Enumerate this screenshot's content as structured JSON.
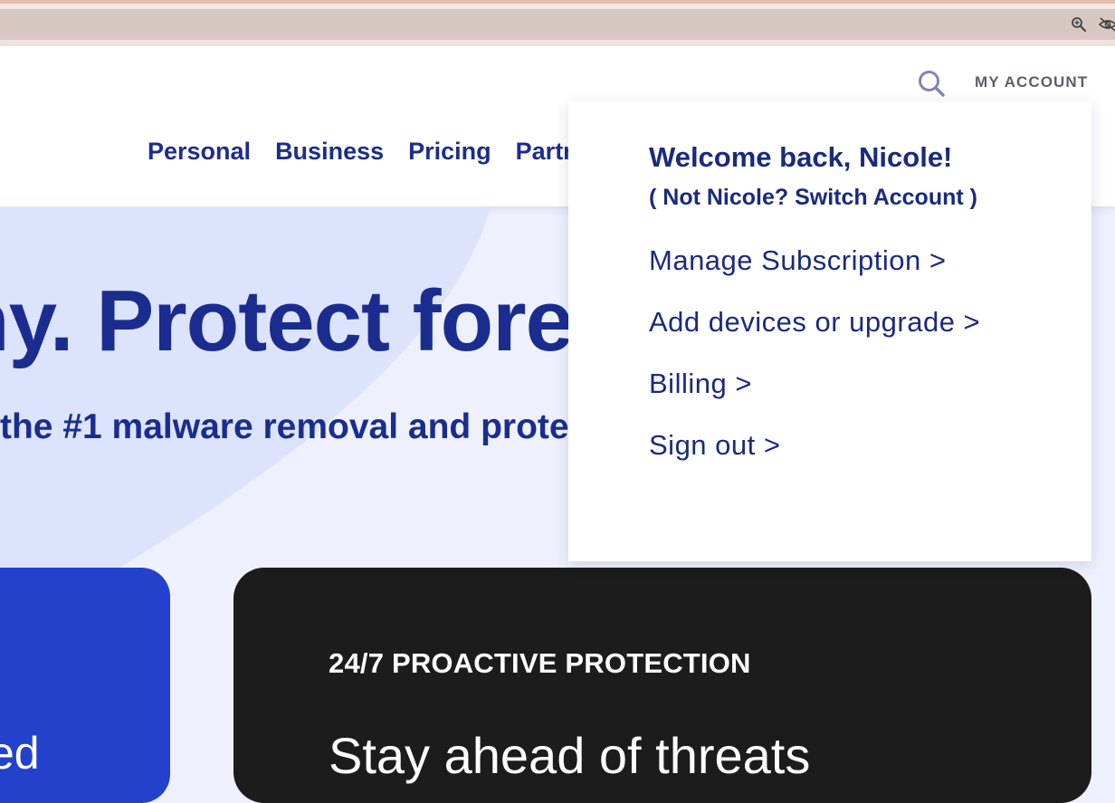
{
  "browser": {
    "icons": [
      "zoom-in-icon",
      "eye-slash-icon"
    ]
  },
  "header": {
    "account_label": "MY ACCOUNT",
    "search_icon": "search-icon",
    "nav": [
      "Personal",
      "Business",
      "Pricing",
      "Partn"
    ]
  },
  "hero": {
    "title": "ny. Protect forev",
    "subtitle": "the #1 malware removal and prote"
  },
  "cards": {
    "blue_text": "ed",
    "dark_eyebrow": "24/7 PROACTIVE PROTECTION",
    "dark_heading": "Stay ahead of threats"
  },
  "dropdown": {
    "welcome": "Welcome back, Nicole!",
    "switch": "( Not Nicole? Switch Account )",
    "links": [
      "Manage Subscription >",
      "Add devices or upgrade >",
      "Billing >",
      "Sign out >"
    ]
  },
  "colors": {
    "brand_navy": "#1a2d8f",
    "accent_blue": "#2441cc",
    "dark_card": "#1c1c1c",
    "hero_bg": "#eef1fd",
    "browser_bar": "#d7c8c3"
  }
}
